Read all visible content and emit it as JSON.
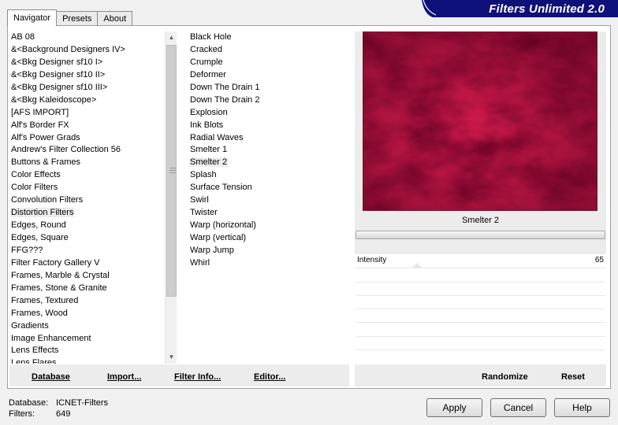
{
  "tabs": [
    "Navigator",
    "Presets",
    "About"
  ],
  "header": {
    "title": "Filters Unlimited 2.0",
    "color": "#10107a"
  },
  "categories": [
    "AB 08",
    "&<Background Designers IV>",
    "&<Bkg Designer sf10 I>",
    "&<Bkg Designer sf10 II>",
    "&<Bkg Designer sf10 III>",
    "&<Bkg Kaleidoscope>",
    "[AFS IMPORT]",
    "Alf's Border FX",
    "Alf's Power Grads",
    "Andrew's Filter Collection 56",
    "Buttons & Frames",
    "Color Effects",
    "Color Filters",
    "Convolution Filters",
    "Distortion Filters",
    "Edges, Round",
    "Edges, Square",
    "FFG???",
    "Filter Factory Gallery V",
    "Frames, Marble & Crystal",
    "Frames, Stone & Granite",
    "Frames, Textured",
    "Frames, Wood",
    "Gradients",
    "Image Enhancement",
    "Lens Effects",
    "Lens Flares"
  ],
  "selected_category": "Distortion Filters",
  "filters": [
    "Black Hole",
    "Cracked",
    "Crumple",
    "Deformer",
    "Down The Drain 1",
    "Down The Drain 2",
    "Explosion",
    "Ink Blots",
    "Radial Waves",
    "Smelter 1",
    "Smelter 2",
    "Splash",
    "Surface Tension",
    "Swirl",
    "Twister",
    "Warp (horizontal)",
    "Warp (vertical)",
    "Warp Jump",
    "Whirl"
  ],
  "selected_filter": "Smelter 2",
  "preview": {
    "filter_name": "Smelter 2",
    "color": "#b8123f"
  },
  "control": {
    "label": "Intensity",
    "value": "65"
  },
  "left_buttons": {
    "database": "Database",
    "import": "Import...",
    "filter_info": "Filter Info...",
    "editor": "Editor..."
  },
  "right_buttons": {
    "randomize": "Randomize",
    "reset": "Reset"
  },
  "status": {
    "database_label": "Database:",
    "database_value": "ICNET-Filters",
    "filters_label": "Filters:",
    "filters_value": "649"
  },
  "dialog_buttons": {
    "apply": "Apply",
    "cancel": "Cancel",
    "help": "Help"
  }
}
